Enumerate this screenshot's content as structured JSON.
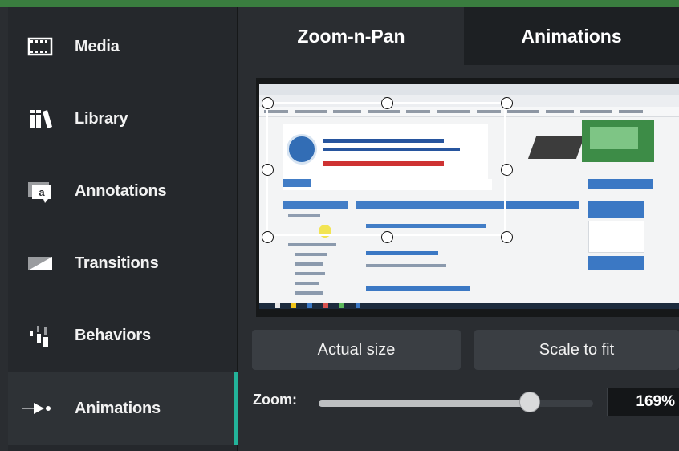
{
  "sidebar": {
    "items": [
      {
        "label": "Media",
        "icon": "media-filmstrip-icon"
      },
      {
        "label": "Library",
        "icon": "library-books-icon"
      },
      {
        "label": "Annotations",
        "icon": "annotation-speech-icon"
      },
      {
        "label": "Transitions",
        "icon": "transition-icon"
      },
      {
        "label": "Behaviors",
        "icon": "behaviors-icon"
      },
      {
        "label": "Animations",
        "icon": "animation-arrow-icon",
        "active": true
      }
    ]
  },
  "tabs": [
    {
      "label": "Zoom-n-Pan",
      "active": true
    },
    {
      "label": "Animations",
      "active": false
    }
  ],
  "preview": {
    "thumbnail_description": "Browser screenshot of a university online learning system page"
  },
  "buttons": {
    "actual_size": "Actual size",
    "scale_to_fit": "Scale to fit"
  },
  "zoom": {
    "label": "Zoom:",
    "value": "169%",
    "slider_level": 0.77
  },
  "colors": {
    "accent": "#23b39a",
    "top_border": "#3a7d3f",
    "sidebar_bg": "#25282c",
    "panel_bg": "#2a2d31"
  }
}
